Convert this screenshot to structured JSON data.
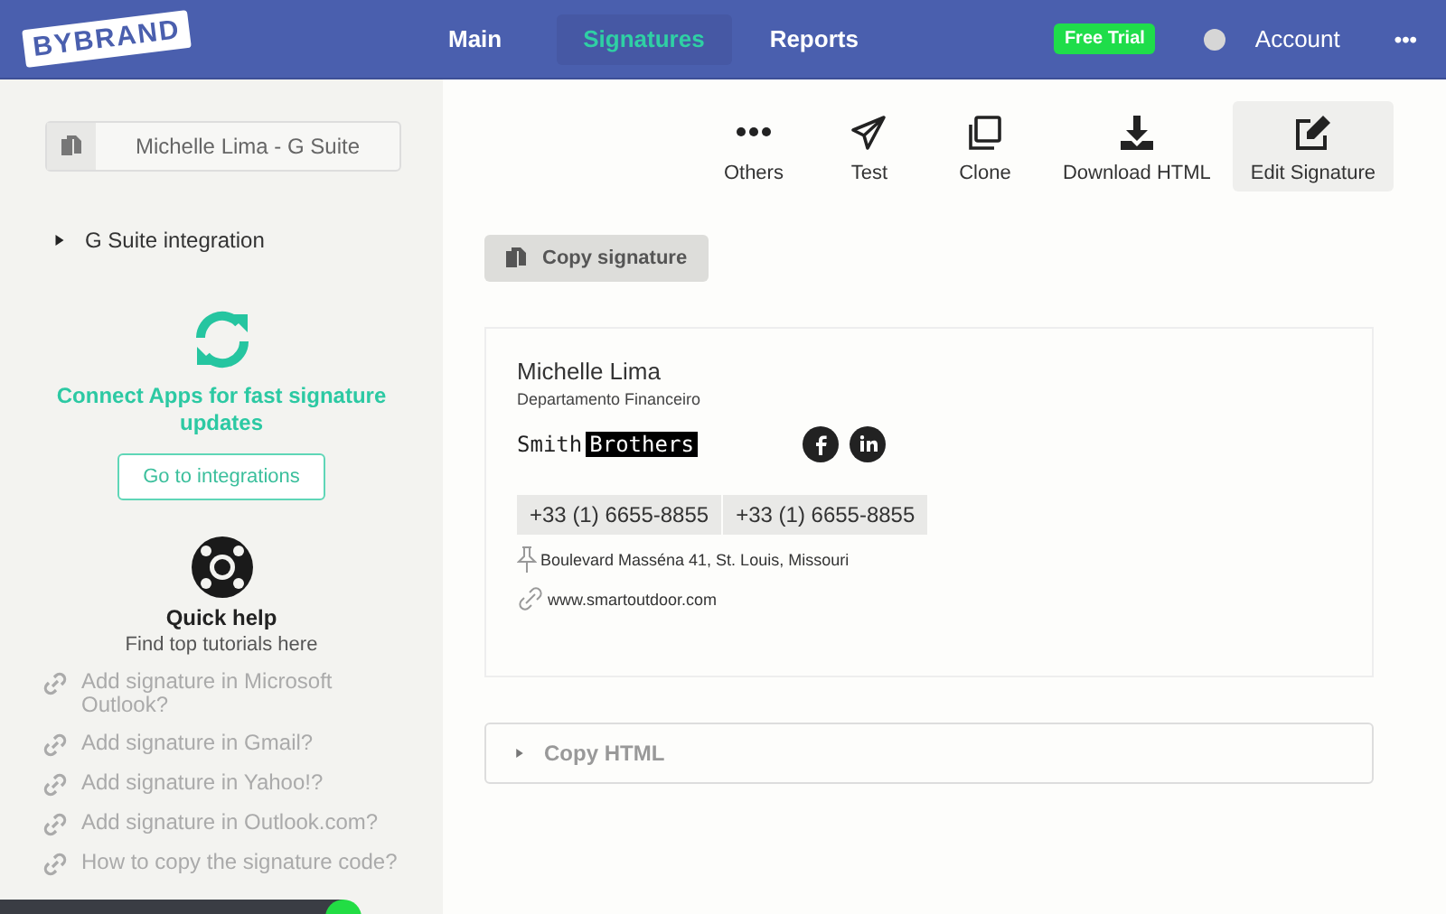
{
  "header": {
    "logo": "BYBRAND",
    "nav": [
      {
        "label": "Main",
        "selected": false
      },
      {
        "label": "Signatures",
        "selected": true
      },
      {
        "label": "Reports",
        "selected": false
      }
    ],
    "trial_badge": "Free Trial",
    "account": "Account",
    "more": "•••"
  },
  "sidebar": {
    "signature_selector": "Michelle Lima - G Suite",
    "integration": {
      "label": "G Suite integration",
      "expanded": false
    },
    "connect": {
      "text": "Connect Apps for fast signature updates",
      "button": "Go to integrations"
    },
    "quick_help": {
      "title": "Quick help",
      "subtitle": "Find top tutorials here",
      "links": [
        "Add signature in Microsoft Outlook?",
        "Add signature in Gmail?",
        "Add signature in Yahoo!?",
        "Add signature in Outlook.com?",
        "How to copy the signature code?"
      ]
    }
  },
  "toolbar": [
    {
      "label": "Others",
      "kind": "dots",
      "selected": false
    },
    {
      "label": "Test",
      "kind": "send",
      "selected": false
    },
    {
      "label": "Clone",
      "kind": "clone",
      "selected": false
    },
    {
      "label": "Download HTML",
      "kind": "download",
      "selected": false
    },
    {
      "label": "Edit Signature",
      "kind": "edit",
      "selected": true
    }
  ],
  "copy_signature": "Copy signature",
  "signature": {
    "name": "Michelle Lima",
    "department": "Departamento Financeiro",
    "logo": {
      "first": "Smith",
      "second": "Brothers"
    },
    "social": [
      {
        "kind": "facebook"
      },
      {
        "kind": "linkedin"
      }
    ],
    "phones": [
      "+33 (1) 6655-8855",
      "+33 (1) 6655-8855"
    ],
    "address": "Boulevard Masséna 41, St. Louis, Missouri",
    "website": "www.smartoutdoor.com"
  },
  "copy_html": {
    "label": "Copy HTML",
    "expanded": false
  }
}
